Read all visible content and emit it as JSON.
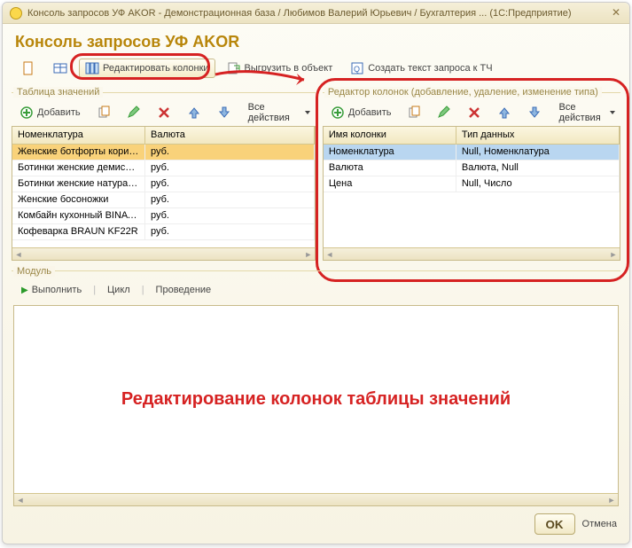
{
  "window": {
    "title": "Консоль запросов УФ AKOR - Демонстрационная база / Любимов Валерий Юрьевич / Бухгалтерия ...  (1С:Предприятие)"
  },
  "app": {
    "title": "Консоль запросов УФ AKOR"
  },
  "toolbar": {
    "edit_cols": "Редактировать колонки",
    "export_obj": "Выгрузить в объект",
    "create_query": "Создать текст запроса к ТЧ"
  },
  "left": {
    "section": "Таблица значений",
    "add": "Добавить",
    "all_actions": "Все действия",
    "headers": {
      "name": "Номенклатура",
      "currency": "Валюта"
    },
    "rows": [
      {
        "name": "Женские ботфорты корич…",
        "currency": "руб."
      },
      {
        "name": "Ботинки женские демисе…",
        "currency": "руб."
      },
      {
        "name": "Ботинки женские натурал…",
        "currency": "руб."
      },
      {
        "name": "Женские босоножки",
        "currency": "руб."
      },
      {
        "name": "Комбайн кухонный BINAT…",
        "currency": "руб."
      },
      {
        "name": "Кофеварка BRAUN KF22R",
        "currency": "руб."
      }
    ]
  },
  "right": {
    "section": "Редактор колонок (добавление, удаление, изменение типа)",
    "add": "Добавить",
    "all_actions": "Все действия",
    "headers": {
      "col": "Имя колонки",
      "type": "Тип данных"
    },
    "rows": [
      {
        "col": "Номенклатура",
        "type": "Null, Номенклатура"
      },
      {
        "col": "Валюта",
        "type": "Валюта, Null"
      },
      {
        "col": "Цена",
        "type": "Null, Число"
      }
    ]
  },
  "module": {
    "label": "Модуль",
    "run": "Выполнить",
    "loop": "Цикл",
    "post": "Проведение",
    "annotation": "Редактирование колонок таблицы значений"
  },
  "footer": {
    "ok": "OK",
    "cancel": "Отмена"
  }
}
